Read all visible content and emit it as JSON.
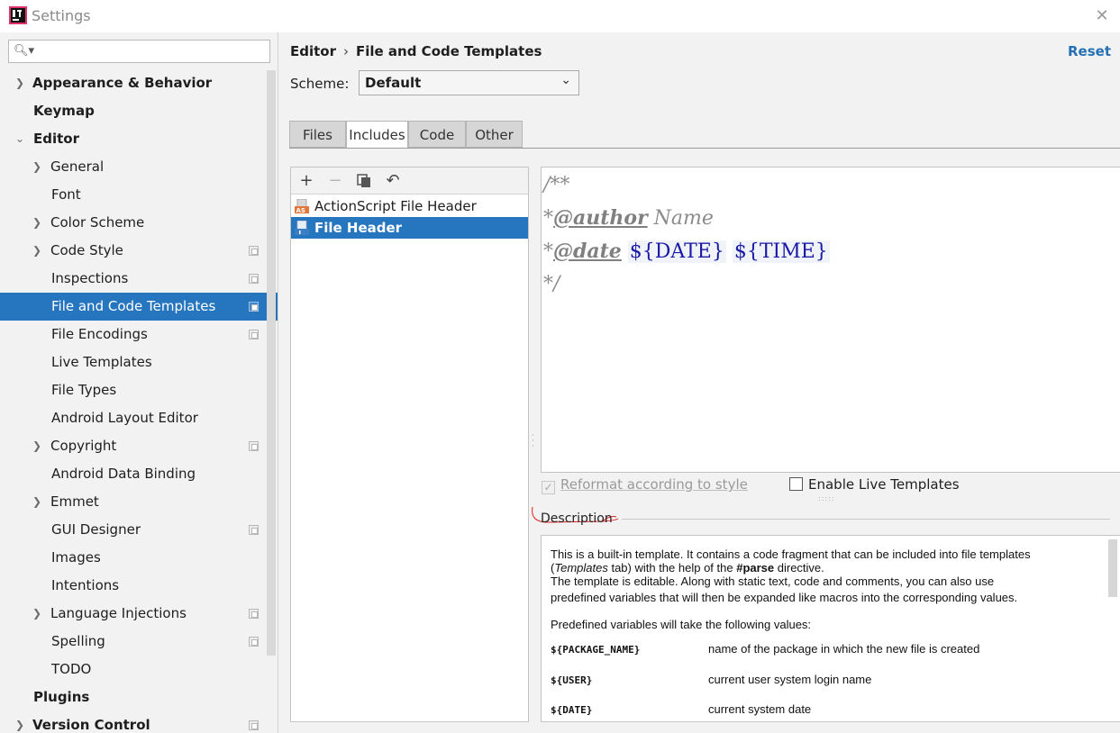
{
  "window": {
    "title": "Settings"
  },
  "search": {
    "placeholder": ""
  },
  "sidebar": {
    "items": [
      {
        "label": "Appearance & Behavior"
      },
      {
        "label": "Keymap"
      },
      {
        "label": "Editor"
      },
      {
        "label": "General"
      },
      {
        "label": "Font"
      },
      {
        "label": "Color Scheme"
      },
      {
        "label": "Code Style"
      },
      {
        "label": "Inspections"
      },
      {
        "label": "File and Code Templates"
      },
      {
        "label": "File Encodings"
      },
      {
        "label": "Live Templates"
      },
      {
        "label": "File Types"
      },
      {
        "label": "Android Layout Editor"
      },
      {
        "label": "Copyright"
      },
      {
        "label": "Android Data Binding"
      },
      {
        "label": "Emmet"
      },
      {
        "label": "GUI Designer"
      },
      {
        "label": "Images"
      },
      {
        "label": "Intentions"
      },
      {
        "label": "Language Injections"
      },
      {
        "label": "Spelling"
      },
      {
        "label": "TODO"
      },
      {
        "label": "Plugins"
      },
      {
        "label": "Version Control"
      }
    ]
  },
  "header": {
    "breadcrumb_parent": "Editor",
    "breadcrumb_sep": "›",
    "breadcrumb_current": "File and Code Templates",
    "reset_label": "Reset"
  },
  "scheme": {
    "label": "Scheme:",
    "value": "Default"
  },
  "tabs": [
    {
      "label": "Files"
    },
    {
      "label": "Includes"
    },
    {
      "label": "Code"
    },
    {
      "label": "Other"
    }
  ],
  "templates": [
    {
      "name": "ActionScript File Header",
      "icon": "actionscript-file-icon"
    },
    {
      "name": "File Header",
      "icon": "include-file-icon"
    }
  ],
  "editor": {
    "line1": "/**",
    "line2_star": "*",
    "line2_tag": "@author",
    "line2_text": " Name",
    "line3_star": "*",
    "line3_tag": "@date",
    "line3_var1": "${DATE}",
    "line3_var2": "${TIME}",
    "line4": "*/"
  },
  "options": {
    "reformat_label": "Reformat according to style",
    "reformat_checked": true,
    "live_templates_label": "Enable Live Templates",
    "live_templates_checked": false
  },
  "description": {
    "label": "Description",
    "p1a": "This is a built-in template. It contains a code fragment that can be included into file templates",
    "p1b_open": "(",
    "p1b_italic": "Templates",
    "p1b_mid": " tab) with the help of the ",
    "p1b_bold": "#parse",
    "p1b_end": " directive.",
    "p2a": "The template is editable. Along with static text, code and comments, you can also use",
    "p2b": "predefined variables that will then be expanded like macros into the corresponding values.",
    "p3": "Predefined variables will take the following values:",
    "variables": [
      {
        "name": "${PACKAGE_NAME}",
        "desc": "name of the package in which the new file is created"
      },
      {
        "name": "${USER}",
        "desc": "current user system login name"
      },
      {
        "name": "${DATE}",
        "desc": "current system date"
      }
    ]
  },
  "colors": {
    "accent": "#2675bf",
    "link": "#2470b3",
    "variable": "#1a1aa6"
  }
}
